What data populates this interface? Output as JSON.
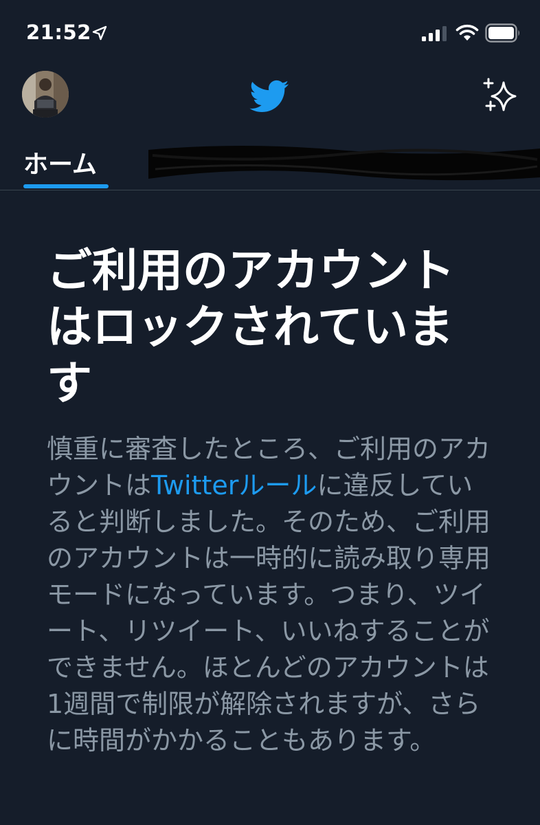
{
  "status_bar": {
    "time": "21:52",
    "icons": [
      "location-arrow-icon",
      "cellular-signal-icon",
      "wifi-icon",
      "battery-icon"
    ]
  },
  "header": {
    "avatar": "profile-avatar",
    "logo": "twitter-bird-icon",
    "action": "sparkle-icon",
    "accent_color": "#1d9bf0"
  },
  "tabs": {
    "home_label": "ホーム",
    "redacted_label": "redacted"
  },
  "notice": {
    "title": "ご利用のアカウントはロックされています",
    "body_before": "慎重に審査したところ、ご利用のアカウントは",
    "rules_link": "Twitterルール",
    "body_after": "に違反していると判断しました。そのため、ご利用のアカウントは一時的に読み取り専用モードになっています。つまり、ツイート、リツイート、いいねすることができません。ほとんどのアカウントは1週間で制限が解除されますが、さらに時間がかかることもあります。"
  },
  "colors": {
    "background": "#151d2a",
    "body_text": "#8b98a5",
    "link": "#1d9bf0"
  }
}
